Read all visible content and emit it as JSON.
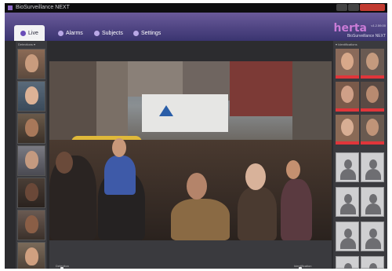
{
  "window": {
    "title": "BioSurveillance NEXT"
  },
  "nav": {
    "tabs": [
      {
        "label": "Live",
        "icon": "camera-icon",
        "active": true
      },
      {
        "label": "Alarms",
        "icon": "alarm-icon",
        "active": false
      },
      {
        "label": "Subjects",
        "icon": "subjects-icon",
        "active": false
      },
      {
        "label": "Settings",
        "icon": "gear-icon",
        "active": false
      }
    ]
  },
  "brand": {
    "logo": "herta",
    "version": "v1.2.59.00",
    "product": "BioSurveillance NEXT"
  },
  "left_panel": {
    "header": "Detections ▾",
    "count": 7
  },
  "right_panel": {
    "header": "▾ Identifications",
    "face_count": 6,
    "placeholder_count": 8
  },
  "bottom": {
    "left_slider": "Detection",
    "right_slider": "Identification"
  },
  "colors": {
    "accent": "#6a4db8",
    "logo": "#c97bd6",
    "alert": "#e0353a"
  }
}
